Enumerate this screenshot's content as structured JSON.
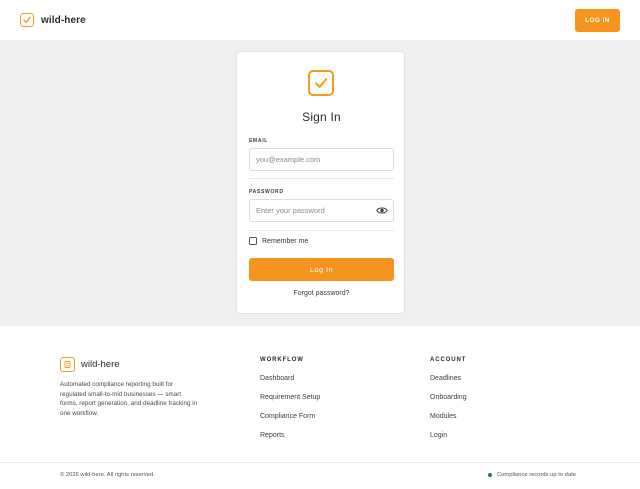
{
  "header": {
    "brand_name": "wild-here",
    "login_label": "LOG IN"
  },
  "signin": {
    "title": "Sign In",
    "email_label": "EMAIL",
    "email_placeholder": "you@example.com",
    "password_label": "PASSWORD",
    "password_placeholder": "Enter your password",
    "remember_label": "Remember me",
    "submit_label": "Log In",
    "forgot_label": "Forgot password?"
  },
  "footer": {
    "brand_name": "wild-here",
    "description": "Automated compliance reporting built for regulated small-to-mid businesses — smart forms, report generation, and deadline tracking in one workflow.",
    "workflow": {
      "title": "WORKFLOW",
      "links": [
        "Dashboard",
        "Requirement Setup",
        "Compliance Form",
        "Reports"
      ]
    },
    "account": {
      "title": "ACCOUNT",
      "links": [
        "Deadlines",
        "Onboarding",
        "Modules",
        "Login"
      ]
    },
    "copyright": "© 2026 wild-here. All rights reserved.",
    "status_text": "Compliance records up to date"
  },
  "colors": {
    "accent": "#f7941d",
    "status_ok": "#1e7a5a",
    "page_bg": "#efefef"
  },
  "icons": {
    "brand": "checkbox-check-icon",
    "password_toggle": "eye-icon",
    "footer_brand": "document-icon"
  }
}
